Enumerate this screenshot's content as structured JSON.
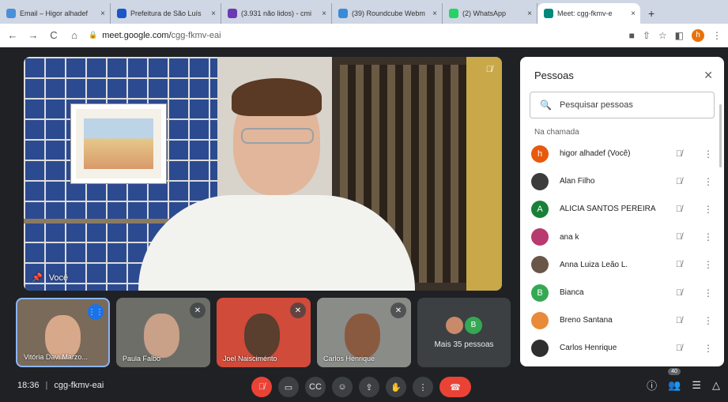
{
  "browser": {
    "tabs": [
      {
        "label": "Email – Higor alhadef",
        "favicon_color": "#4a90d9",
        "active": false
      },
      {
        "label": "Prefeitura de São Luís",
        "favicon_color": "#1a56c8",
        "active": false
      },
      {
        "label": "(3.931 não lidos) - cmi",
        "favicon_color": "#6a3ab2",
        "active": false
      },
      {
        "label": "(39) Roundcube Webm",
        "favicon_color": "#3a8ad8",
        "active": false
      },
      {
        "label": "(2) WhatsApp",
        "favicon_color": "#25d366",
        "active": false
      },
      {
        "label": "Meet: cgg-fkmv-e",
        "favicon_color": "#00897b",
        "active": true
      }
    ],
    "url_host": "meet.google.com/",
    "url_path": "cgg-fkmv-eai",
    "profile_initial": "h"
  },
  "main_video": {
    "name": "Você"
  },
  "thumbnails": [
    {
      "name": "Vitória Davi Marzo...",
      "speaking": true
    },
    {
      "name": "Paula Falbo",
      "speaking": false
    },
    {
      "name": "Joel Naisciménto",
      "speaking": false
    },
    {
      "name": "Carlos Henrique",
      "speaking": false
    }
  ],
  "more_tile": {
    "label": "Mais 35 pessoas",
    "avatar_letter": "B"
  },
  "bottom_bar": {
    "time": "18:36",
    "separator": "|",
    "meeting_code": "cgg-fkmv-eai",
    "people_count": "40"
  },
  "panel": {
    "title": "Pessoas",
    "search_placeholder": "Pesquisar pessoas",
    "section_label": "Na chamada",
    "people": [
      {
        "name": "higor alhadef (Você)",
        "avatar": "h",
        "color": "#e8590c"
      },
      {
        "name": "Alan Filho",
        "avatar": "",
        "color": "#3c3c3c"
      },
      {
        "name": "ALICIA SANTOS PEREIRA",
        "avatar": "A",
        "color": "#188038"
      },
      {
        "name": "ana k",
        "avatar": "",
        "color": "#b83a6e"
      },
      {
        "name": "Anna Luiza Leão L.",
        "avatar": "",
        "color": "#6a5648"
      },
      {
        "name": "Bianca",
        "avatar": "B",
        "color": "#34a853"
      },
      {
        "name": "Breno Santana",
        "avatar": "",
        "color": "#e88a3a"
      },
      {
        "name": "Carlos Henrique",
        "avatar": "",
        "color": "#2f2f2f"
      }
    ]
  }
}
